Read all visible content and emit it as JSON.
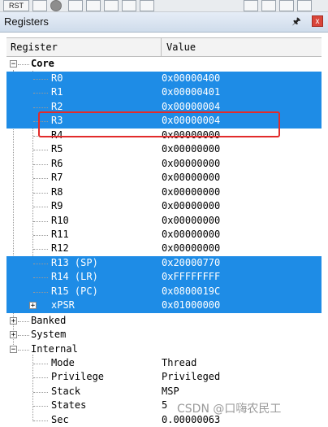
{
  "toolbar": {
    "rst_label": "RST"
  },
  "panel": {
    "title": "Registers",
    "pin_icon": "pin-icon",
    "close_icon": "close-icon"
  },
  "columns": {
    "register": "Register",
    "value": "Value"
  },
  "core": {
    "label": "Core",
    "expander": "⊟"
  },
  "registers": [
    {
      "name": "R0",
      "value": "0x00000400",
      "selected": true
    },
    {
      "name": "R1",
      "value": "0x00000401",
      "selected": true
    },
    {
      "name": "R2",
      "value": "0x00000004",
      "selected": true
    },
    {
      "name": "R3",
      "value": "0x00000004",
      "selected": true
    },
    {
      "name": "R4",
      "value": "0x00000000",
      "selected": false
    },
    {
      "name": "R5",
      "value": "0x00000000",
      "selected": false
    },
    {
      "name": "R6",
      "value": "0x00000000",
      "selected": false
    },
    {
      "name": "R7",
      "value": "0x00000000",
      "selected": false
    },
    {
      "name": "R8",
      "value": "0x00000000",
      "selected": false
    },
    {
      "name": "R9",
      "value": "0x00000000",
      "selected": false
    },
    {
      "name": "R10",
      "value": "0x00000000",
      "selected": false
    },
    {
      "name": "R11",
      "value": "0x00000000",
      "selected": false
    },
    {
      "name": "R12",
      "value": "0x00000000",
      "selected": false
    },
    {
      "name": "R13 (SP)",
      "value": "0x20000770",
      "selected": true
    },
    {
      "name": "R14 (LR)",
      "value": "0xFFFFFFFF",
      "selected": true
    },
    {
      "name": "R15 (PC)",
      "value": "0x0800019C",
      "selected": true
    },
    {
      "name": "xPSR",
      "value": "0x01000000",
      "selected": true
    }
  ],
  "groups": {
    "banked": "Banked",
    "system": "System",
    "internal": "Internal"
  },
  "internal": [
    {
      "name": "Mode",
      "value": "Thread"
    },
    {
      "name": "Privilege",
      "value": "Privileged"
    },
    {
      "name": "Stack",
      "value": "MSP"
    },
    {
      "name": "States",
      "value": "5"
    },
    {
      "name": "Sec",
      "value": "0.00000063"
    }
  ],
  "watermark": "CSDN @口嗨农民工",
  "colors": {
    "selection": "#1e8ce6",
    "highlight_box": "#e22b2b"
  }
}
